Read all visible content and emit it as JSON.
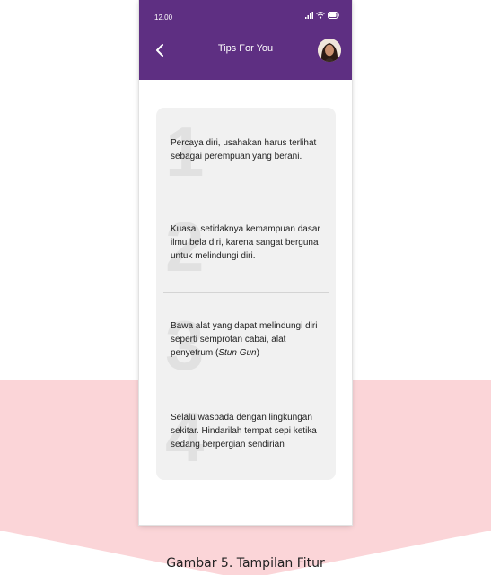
{
  "status_bar": {
    "time": "12.00"
  },
  "app_bar": {
    "title": "Tips For You",
    "back_icon": "chevron-left-icon",
    "avatar": "user-avatar"
  },
  "colors": {
    "app_bar": "#5e2f82",
    "card_background": "#f1f1f1",
    "watermark": "#fbd5d8"
  },
  "tips": [
    {
      "number": "1",
      "text": "Percaya diri, usahakan harus terlihat sebagai perempuan yang berani."
    },
    {
      "number": "2",
      "text": "Kuasai setidaknya kemampuan dasar ilmu bela diri, karena sangat berguna untuk melindungi diri."
    },
    {
      "number": "3",
      "text_before": "Bawa alat yang dapat melindungi diri seperti semprotan cabai, alat penyetrum (",
      "text_italic": "Stun Gun",
      "text_after": ")"
    },
    {
      "number": "4",
      "text": "Selalu waspada dengan lingkungan sekitar. Hindarilah tempat sepi ketika sedang berpergian sendirian"
    }
  ],
  "caption": "Gambar 5. Tampilan Fitur"
}
